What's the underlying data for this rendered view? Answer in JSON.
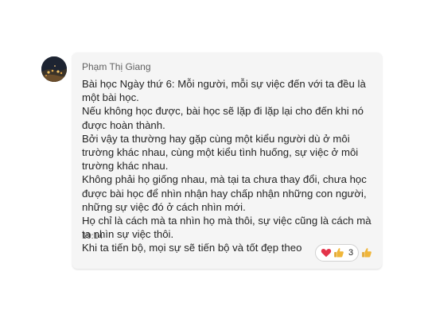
{
  "message": {
    "sender": "Phạm Thị Giang",
    "lines": [
      "Bài học Ngày thứ 6: Mỗi người, mỗi sự việc đến với ta đều là một bài học.",
      "Nếu không học được, bài học sẽ lặp đi lặp lại cho đến khi nó được hoàn thành.",
      "Bởi vậy ta thường hay gặp cùng một kiểu người dù ở môi trường khác nhau, cùng một kiểu tình huống, sự việc ở môi trường khác nhau.",
      "Không phải họ giống nhau, mà tại ta chưa thay đổi, chưa học được bài học để nhìn nhận hay chấp nhận những con người, những sự việc đó ở cách nhìn mới.",
      "Họ chỉ là cách mà ta nhìn họ mà thôi, sự việc cũng là cách mà ta nhìn sự việc thôi.",
      "Khi ta tiến bộ, mọi sự sẽ tiến bộ và tốt đẹp theo"
    ],
    "time": "19:14",
    "reactions": {
      "icons": [
        "heart-icon",
        "thumbs-up-icon"
      ],
      "count": "3"
    },
    "add_reaction_icon": "thumbs-up-icon"
  },
  "colors": {
    "bubble": "#f5f5f5",
    "heart": "#e3344a",
    "thumb": "#f0b63a"
  }
}
